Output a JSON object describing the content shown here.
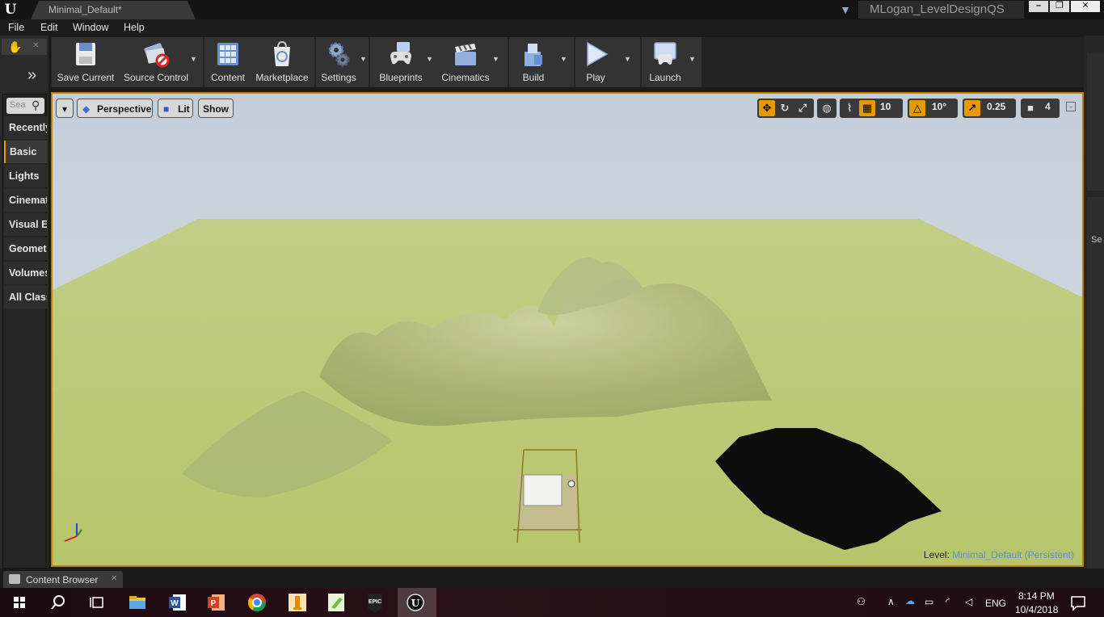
{
  "window": {
    "doc_tab": "Minimal_Default*",
    "project_name": "MLogan_LevelDesignQS",
    "controls": {
      "minimize": "–",
      "maximize": "❐",
      "close": "✕"
    }
  },
  "menu": [
    "File",
    "Edit",
    "Window",
    "Help"
  ],
  "modes": {
    "search_placeholder": "Sea",
    "categories": [
      "Recently",
      "Basic",
      "Lights",
      "Cinemat",
      "Visual Ef",
      "Geomet",
      "Volumes",
      "All Class"
    ],
    "active_category": "Basic"
  },
  "toolbar": {
    "buttons": [
      "Save Current",
      "Source Control",
      "Content",
      "Marketplace",
      "Settings",
      "Blueprints",
      "Cinematics",
      "Build",
      "Play",
      "Launch"
    ]
  },
  "viewport": {
    "menu_button": "▾",
    "perspective": "Perspective",
    "lit": "Lit",
    "show": "Show",
    "grid_snap": "10",
    "rotation_snap": "10°",
    "scale_snap": "0.25",
    "camera_speed": "4",
    "level_label": "Level:",
    "level_name": "Minimal_Default (Persistent)"
  },
  "right_dock": {
    "label": "Se"
  },
  "content_browser": {
    "tab_label": "Content Browser"
  },
  "taskbar": {
    "time": "8:14 PM",
    "date": "10/4/2018",
    "language": "ENG"
  },
  "colors": {
    "accent": "#e59a00",
    "sky": "#c8d3dc",
    "grass": "#bfcd7a"
  }
}
